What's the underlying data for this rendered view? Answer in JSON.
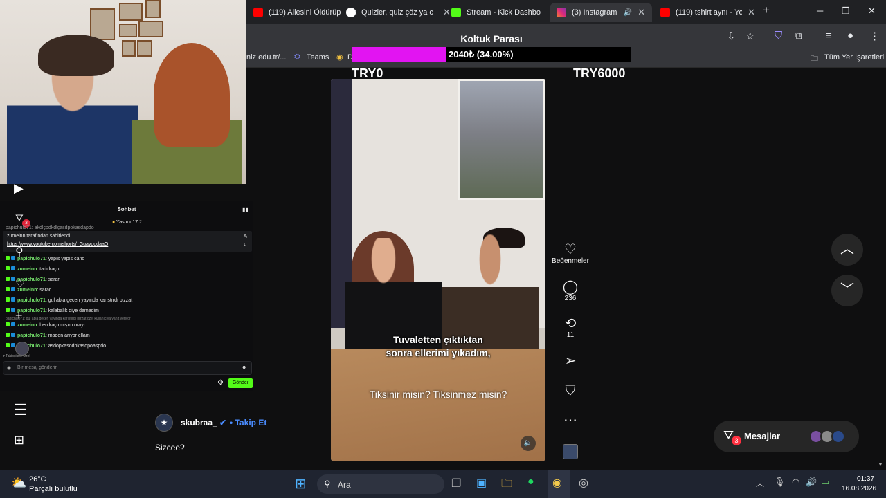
{
  "browser": {
    "tabs": [
      {
        "title": "(119) Ailesini Öldürüp",
        "color": "#ff0000"
      },
      {
        "title": "Quizler, quiz çöz ya c",
        "color": "#ffffff"
      },
      {
        "title": "Stream - Kick Dashbo",
        "color": "#53fc18"
      },
      {
        "title": "(3) Instagram",
        "color": "#e1306c",
        "active": true
      },
      {
        "title": "(119) tshirt aynı - Yo",
        "color": "#ff0000"
      }
    ],
    "bookmarks": {
      "partial_url": "niz.edu.tr/...",
      "teams": "Teams",
      "d": "D",
      "all_bookmarks": "Tüm Yer İşaretleri"
    }
  },
  "goal": {
    "title": "Koltuk Parası",
    "progress_text": "2040₺ (34.00%)",
    "progress": 0.34,
    "min": "TRY0",
    "max": "TRY6000"
  },
  "chat": {
    "title": "Sohbet",
    "top_user": "Yasuoo17",
    "top_count": "2",
    "pinned_by": "zumeinn tarafından sabitlendi",
    "pinned_link": "https://www.youtube.com/shorts/_GuayqodaaQ",
    "clipped_line": "papichulo71: akdlçpdkdlçasdpokasdapdo",
    "messages": [
      {
        "user": "zumeinn",
        "text": "tadı kaçtı"
      },
      {
        "user": "papichulo71",
        "text": "sarar"
      },
      {
        "user": "zumeinn",
        "text": "sarar"
      },
      {
        "user": "papichulo71",
        "text": "gul abla gecen yayında karıstırdı bizzat"
      },
      {
        "user": "papichulo71",
        "text": "kalabalık diye demedim"
      },
      {
        "user": "zumeinn",
        "text": "ben kaçırmışım orayı"
      },
      {
        "user": "papichulo71",
        "text": "maden arıyor ellam"
      },
      {
        "user": "papichulo71",
        "text": "asdopkasodpkasdpoaspdo"
      }
    ],
    "first_message": {
      "user": "papichulo71",
      "text": "yapıs yapıs cano"
    },
    "reply_note": "papichulo71: gul abla gecen yayında karıstırdı bizzat özel kullanıcıya yanıt veriyor",
    "followers_only": "Takipçilere Özel",
    "input_placeholder": "Bir mesaj gönderin",
    "send_label": "Gönder",
    "notif_count": "3"
  },
  "reel": {
    "subtitle_line1": "Tuvaletten çıktıktan",
    "subtitle_line2": "sonra ellerimi yıkadım,",
    "subtitle_question": "Tiksinir misin? Tiksinmez misin?",
    "likes_label": "Beğenmeler",
    "comments_count": "236",
    "reposts_count": "11",
    "author": "skubraa_",
    "follow_label": "Takip Et",
    "caption": "Sizcee?"
  },
  "messages_pill": {
    "label": "Mesajlar",
    "badge": "3"
  },
  "taskbar": {
    "temperature": "26°C",
    "weather": "Parçalı bulutlu",
    "search_label": "Ara",
    "time": "01:37",
    "date": "16.08.2026"
  }
}
